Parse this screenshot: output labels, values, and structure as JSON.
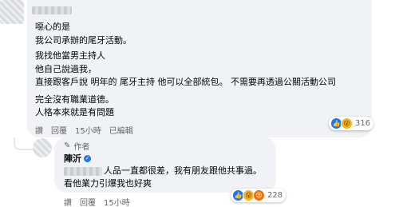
{
  "main_comment": {
    "lines": [
      "噁心的是",
      "我公司承辦的尾牙活動。",
      "我找他當男主持人",
      "他自己說過我，",
      "直接跟客戶說 明年的 尾牙主持 他可以全部統包。 不需要再透過公關活動公司",
      "完全沒有職業道德。",
      "人格本來就是有問題"
    ],
    "actions": [
      "讚",
      "回覆",
      "15小時",
      "已編輯"
    ],
    "reactions": {
      "icons": [
        "like",
        "wow"
      ],
      "count": "316"
    }
  },
  "reply": {
    "author_badge": "作者",
    "author_name": "陣沂",
    "lines": [
      "人品一直都很差，我有朋友跟他共事過。",
      "看他業力引爆我也好爽"
    ],
    "actions": [
      "讚",
      "回覆",
      "15小時"
    ],
    "reactions": {
      "icons": [
        "like",
        "wow",
        "angry"
      ],
      "count": "228"
    }
  }
}
